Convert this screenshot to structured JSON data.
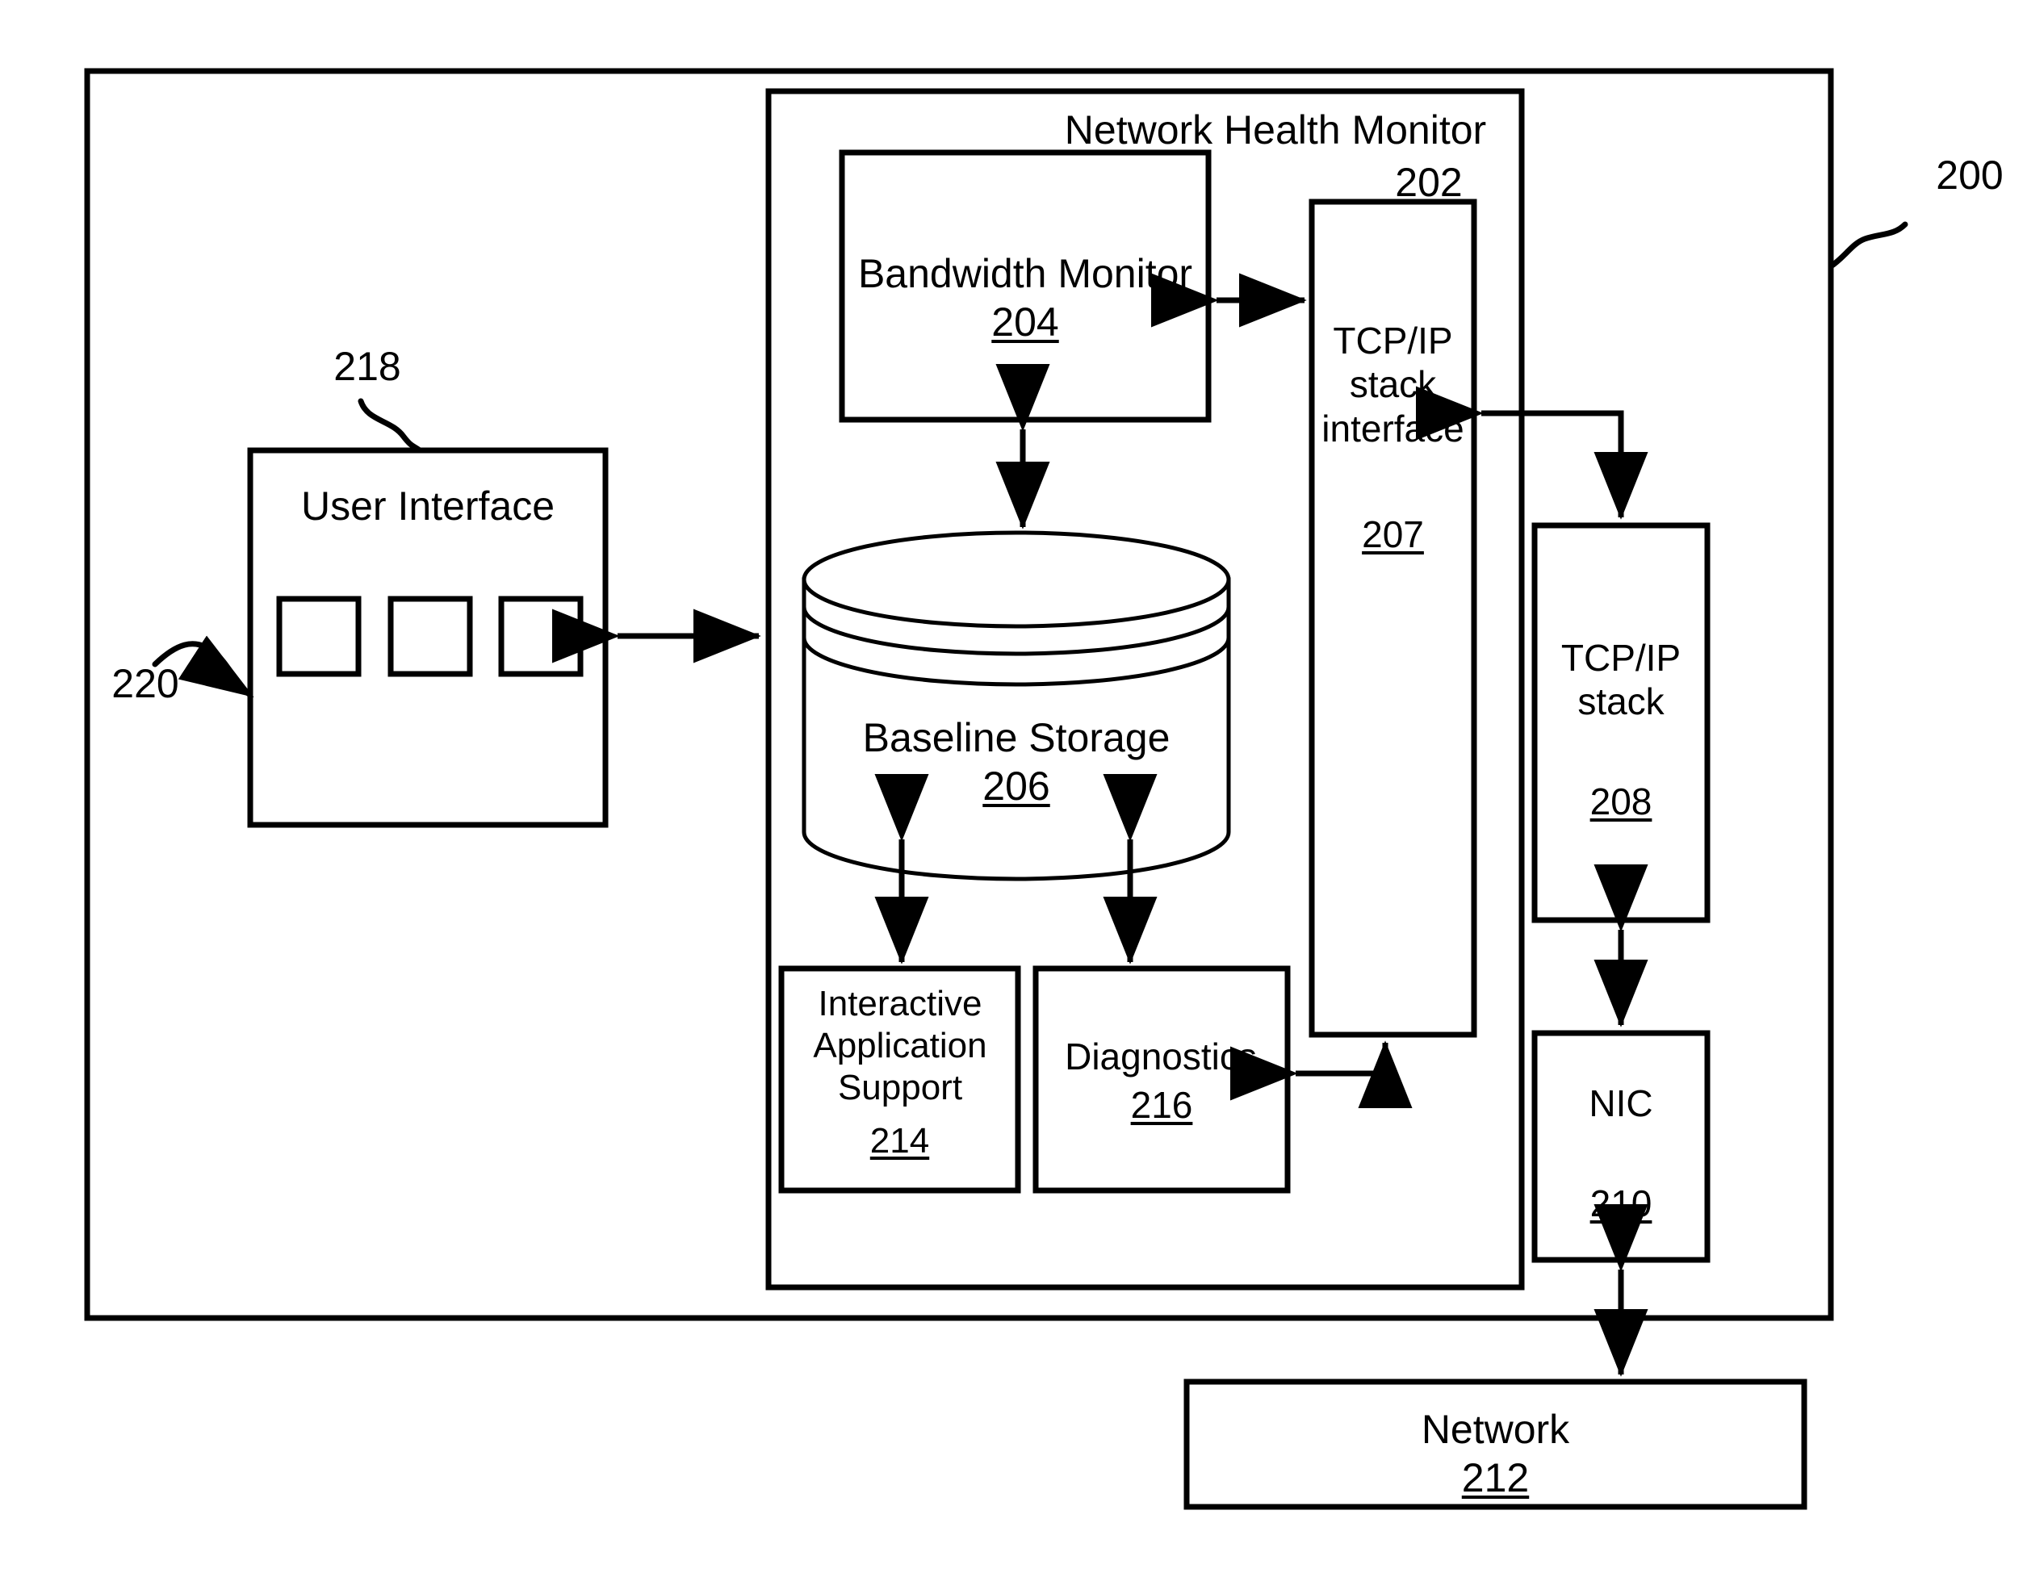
{
  "figure": {
    "system_ref": "200",
    "ui_ref": "218",
    "ui_pointer_ref": "220"
  },
  "outer_system": {
    "name": "system-boundary",
    "ref": "200"
  },
  "network_health_monitor": {
    "title": "Network Health Monitor",
    "ref": "202"
  },
  "blocks": {
    "bandwidth_monitor": {
      "label": "Bandwidth Monitor",
      "ref": "204"
    },
    "baseline_storage": {
      "label": "Baseline Storage",
      "ref": "206"
    },
    "tcp_ip_stack_interface": {
      "label": "TCP/IP\nstack\ninterface",
      "ref": "207"
    },
    "tcp_ip_stack": {
      "label": "TCP/IP\nstack",
      "ref": "208"
    },
    "nic": {
      "label": "NIC",
      "ref": "210"
    },
    "network": {
      "label": "Network",
      "ref": "212"
    },
    "interactive_application_support": {
      "label": "Interactive\nApplication\nSupport",
      "ref": "214"
    },
    "diagnostics": {
      "label": "Diagnostics",
      "ref": "216"
    },
    "user_interface": {
      "label": "User Interface",
      "ref": "218"
    }
  },
  "user_interface_widgets": [
    {
      "label": ""
    },
    {
      "label": ""
    },
    {
      "label": ""
    }
  ],
  "connections": [
    {
      "from": "user-interface",
      "to": "network-health-monitor",
      "style": "double-arrow"
    },
    {
      "from": "bandwidth-monitor",
      "to": "tcp-ip-stack-interface",
      "style": "double-arrow"
    },
    {
      "from": "bandwidth-monitor",
      "to": "baseline-storage",
      "style": "double-arrow"
    },
    {
      "from": "baseline-storage",
      "to": "interactive-application-support",
      "style": "double-arrow"
    },
    {
      "from": "baseline-storage",
      "to": "diagnostics",
      "style": "double-arrow"
    },
    {
      "from": "tcp-ip-stack",
      "to": "tcp-ip-stack-interface",
      "style": "single-arrow"
    },
    {
      "from": "tcp-ip-stack-interface",
      "to": "tcp-ip-stack",
      "style": "single-arrow"
    },
    {
      "from": "tcp-ip-stack-interface",
      "to": "diagnostics",
      "style": "single-arrow"
    },
    {
      "from": "tcp-ip-stack",
      "to": "nic",
      "style": "double-arrow"
    },
    {
      "from": "nic",
      "to": "network",
      "style": "double-arrow"
    }
  ]
}
